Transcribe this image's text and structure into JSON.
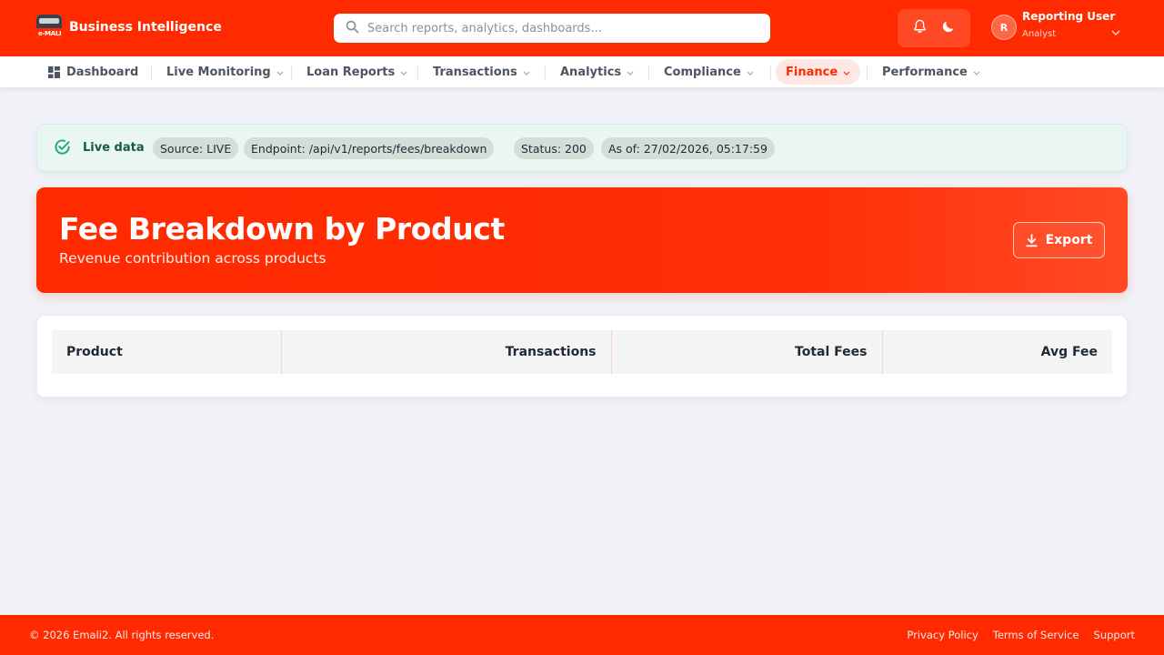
{
  "app": {
    "brand_name": "Business Intelligence",
    "logo_text": "e-MALI"
  },
  "search": {
    "placeholder": "Search reports, analytics, dashboards..."
  },
  "user": {
    "initial": "R",
    "name": "Reporting User",
    "role": "Analyst"
  },
  "nav": {
    "items": [
      {
        "label": "Dashboard"
      },
      {
        "label": "Live Monitoring"
      },
      {
        "label": "Loan Reports"
      },
      {
        "label": "Transactions"
      },
      {
        "label": "Analytics"
      },
      {
        "label": "Compliance"
      },
      {
        "label": "Finance"
      },
      {
        "label": "Performance"
      }
    ],
    "active": "Finance"
  },
  "live": {
    "label": "Live data",
    "source": "Source: LIVE",
    "endpoint": "Endpoint: /api/v1/reports/fees/breakdown",
    "status": "Status: 200",
    "as_of": "As of: 27/02/2026, 05:17:59"
  },
  "hero": {
    "title": "Fee Breakdown by Product",
    "subtitle": "Revenue contribution across products",
    "export_label": "Export"
  },
  "table": {
    "columns": [
      "Product",
      "Transactions",
      "Total Fees",
      "Avg Fee"
    ],
    "rows": []
  },
  "footer": {
    "copyright": "© 2026 Emali2. All rights reserved.",
    "links": [
      "Privacy Policy",
      "Terms of Service",
      "Support"
    ]
  },
  "colors": {
    "brand": "#ff2a00",
    "live_bg": "#e9f6f1",
    "live_text": "#145c41",
    "page_bg": "#f0f2f7"
  }
}
